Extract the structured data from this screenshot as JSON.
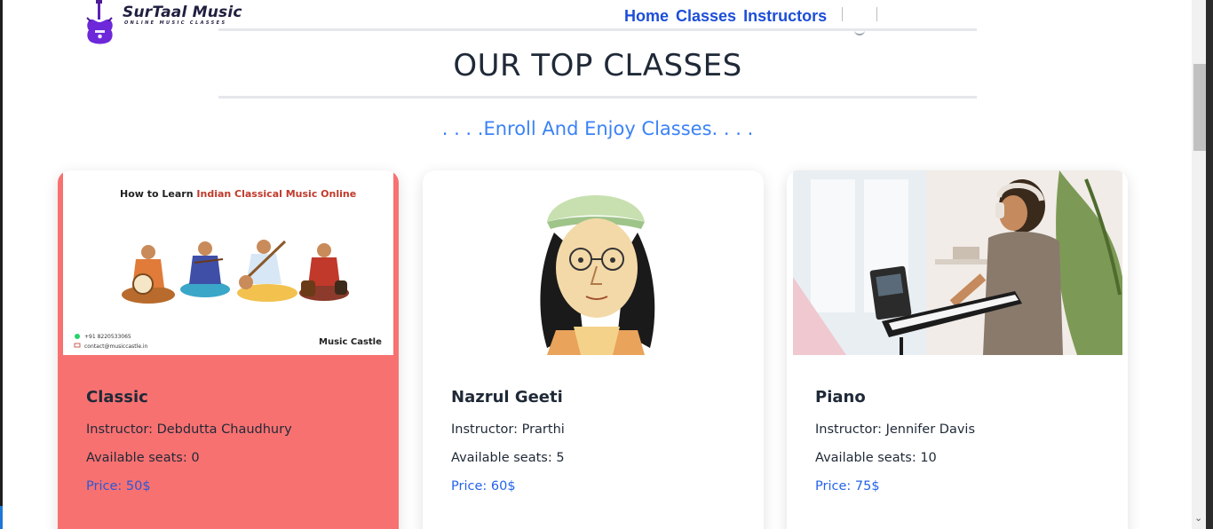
{
  "header": {
    "logo_title": "SurTaal Music",
    "logo_subtitle": "ONLINE MUSIC CLASSES",
    "nav": [
      "Home",
      "Classes",
      "Instructors"
    ]
  },
  "section": {
    "title": "OUR TOP CLASSES",
    "subtitle": ". . . .Enroll And Enjoy Classes. . . ."
  },
  "cards": [
    {
      "image_title_prefix": "How to Learn ",
      "image_title_highlight": "Indian Classical Music Online",
      "image_phone": "+91 8220533065",
      "image_email": "contact@musiccastle.in",
      "image_brand": "Music Castle",
      "title": "Classic",
      "instructor": "Instructor: Debdutta Chaudhury",
      "seats": "Available seats: 0",
      "price": "Price: 50$"
    },
    {
      "title": "Nazrul Geeti",
      "instructor": "Instructor: Prarthi",
      "seats": "Available seats: 5",
      "price": "Price: 60$"
    },
    {
      "title": "Piano",
      "instructor": "Instructor: Jennifer Davis",
      "seats": "Available seats: 10",
      "price": "Price: 75$"
    }
  ],
  "colors": {
    "nav": "#1d4ed8",
    "subtitle": "#3b82f6",
    "highlight_card": "#f87171",
    "price": "#2563eb"
  },
  "icons": {
    "logo": "guitar-icon",
    "whatsapp": "whatsapp-icon",
    "mail": "mail-icon",
    "scroll_down": "chevron-down-icon"
  }
}
